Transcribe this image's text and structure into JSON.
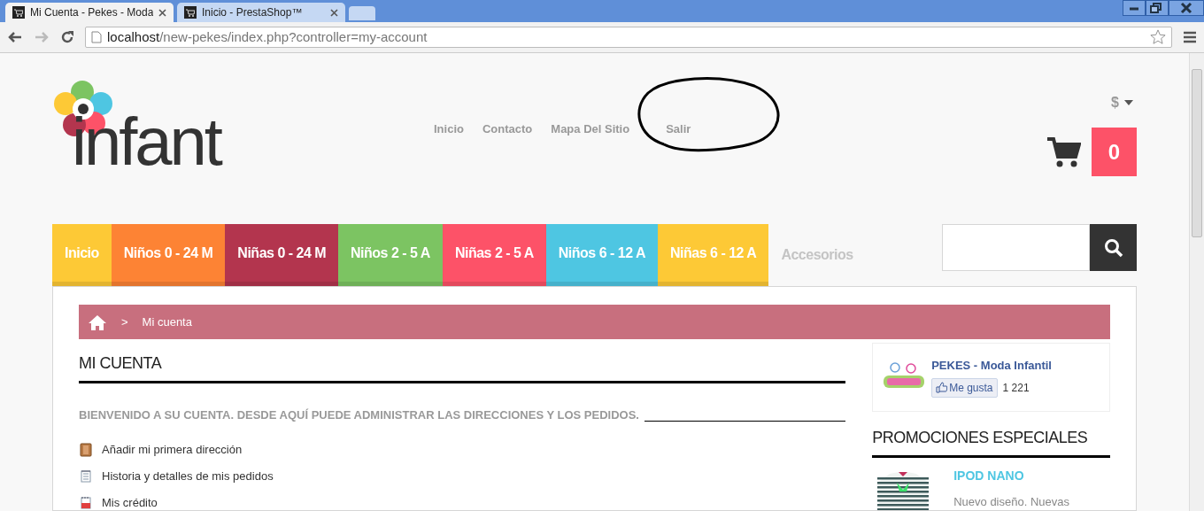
{
  "browser": {
    "tabs": [
      {
        "title": "Mi Cuenta - Pekes - Moda",
        "selected": true
      },
      {
        "title": "Inicio - PrestaShop™",
        "selected": false
      }
    ],
    "address": {
      "host": "localhost",
      "path": "/new-pekes/index.php?controller=my-account"
    }
  },
  "header": {
    "logo": "infant",
    "links": [
      {
        "label": "Inicio"
      },
      {
        "label": "Contacto"
      },
      {
        "label": "Mapa Del Sitio"
      },
      {
        "label": "Salir",
        "circled": true
      }
    ],
    "currency": "$",
    "cart_count": "0"
  },
  "menu": [
    {
      "label": "Inicio",
      "color": "#fdc936"
    },
    {
      "label": "Niños 0 - 24 M",
      "color": "#fd8334"
    },
    {
      "label": "Niñas 0 - 24 M",
      "color": "#b3354e"
    },
    {
      "label": "Niños 2 - 5 A",
      "color": "#7cc462"
    },
    {
      "label": "Niñas 2 - 5 A",
      "color": "#fd5268"
    },
    {
      "label": "Niños 6 - 12 A",
      "color": "#4ec6e2"
    },
    {
      "label": "Niñas 6 - 12 A",
      "color": "#fdc936"
    },
    {
      "label": "Accesorios",
      "color": "#f8f8f8"
    }
  ],
  "breadcrumb": {
    "separator": ">",
    "items": [
      "Mi cuenta"
    ]
  },
  "account": {
    "title": "MI CUENTA",
    "welcome": "BIENVENIDO A SU CUENTA. DESDE AQUÍ PUEDE ADMINISTRAR LAS DIRECCIONES Y LOS PEDIDOS.",
    "links": [
      {
        "kind": "address",
        "label": "Añadir mi primera dirección"
      },
      {
        "kind": "orders",
        "label": "Historia y detalles de mis pedidos"
      },
      {
        "kind": "credit",
        "label": "Mis crédito"
      }
    ]
  },
  "facebook": {
    "page": "PEKES - Moda Infantil",
    "like": "Me gusta",
    "count": "1 221"
  },
  "specials": {
    "title": "PROMOCIONES ESPECIALES",
    "products": [
      {
        "name": "IPOD NANO",
        "description": "Nuevo diseño. Nuevas"
      }
    ]
  }
}
